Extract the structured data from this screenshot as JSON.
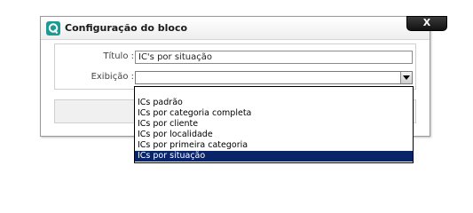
{
  "dialog": {
    "title": "Configuração do bloco",
    "close_label": "X"
  },
  "form": {
    "titulo_label": "Título :",
    "titulo_value": "IC's por situação",
    "exibicao_label": "Exibição :",
    "exibicao_value": ""
  },
  "dropdown": {
    "options": [
      "ICs padrão",
      "ICs por categoria completa",
      "ICs por cliente",
      "ICs por localidade",
      "ICs por primeira categoria",
      "ICs por situação"
    ],
    "highlighted_index": 5
  },
  "colors": {
    "logo": "#1e9a93",
    "selection": "#0a246a"
  }
}
